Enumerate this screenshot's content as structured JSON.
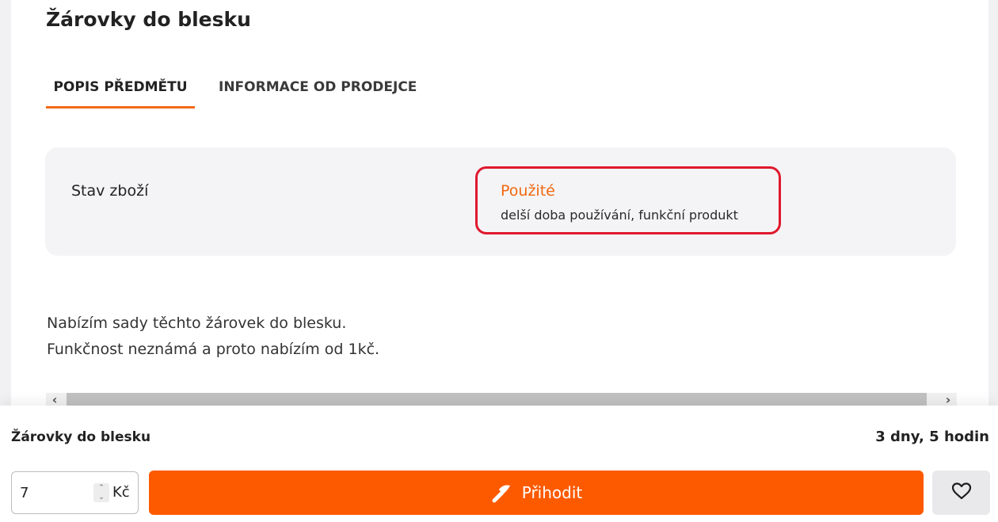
{
  "product": {
    "title": "Žárovky do blesku"
  },
  "tabs": [
    {
      "label": "POPIS PŘEDMĚTU",
      "active": true
    },
    {
      "label": "INFORMACE OD PRODEJCE",
      "active": false
    }
  ],
  "condition": {
    "label": "Stav zboží",
    "value": "Použité",
    "description": "delší doba používání, funkční produkt"
  },
  "description": {
    "lines": [
      "Nabízím sady těchto žárovek do blesku.",
      "Funkčnost neznámá a proto nabízím od 1kč."
    ]
  },
  "bottom_bar": {
    "title": "Žárovky do blesku",
    "time_left": "3 dny, 5 hodin",
    "bid_value": "7",
    "currency": "Kč",
    "bid_button_label": "Přihodit",
    "bid_icon": "auction-hammer-icon",
    "favorite_icon": "heart-icon"
  },
  "colors": {
    "accent": "#fd5a00",
    "condition_value": "#f2670f",
    "highlight_border": "#e0182d"
  }
}
